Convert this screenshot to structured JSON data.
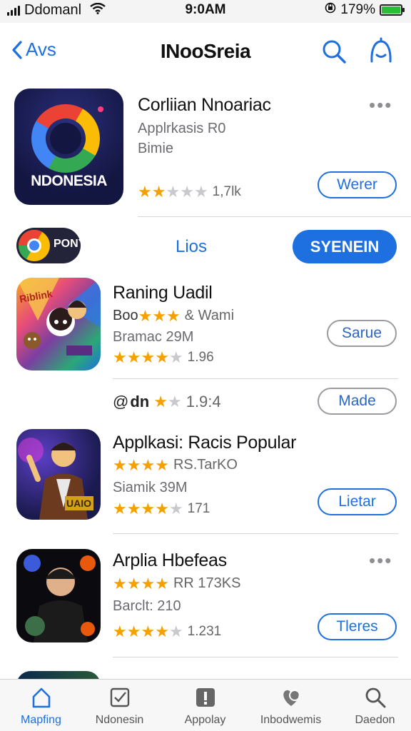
{
  "status_bar": {
    "carrier": "Ddomanl",
    "time": "9:0AM",
    "battery_pct": "179%",
    "icons": [
      "signal-icon",
      "wifi-icon",
      "orientation-lock-icon",
      "battery-icon"
    ]
  },
  "nav": {
    "back_label": "Avs",
    "title": "INooSreia",
    "icons": [
      "search-icon",
      "account-icon"
    ]
  },
  "featured": {
    "icon_text": "NDONESIA",
    "name": "Corliian Nnoariac",
    "subtitle": "Applrkasis R0",
    "category": "Bimie",
    "rating": 2,
    "rating_count": "1,7lk",
    "button": "Werer",
    "more": "•••"
  },
  "banner": {
    "badge_text": "PONY",
    "link": "Lios",
    "button": "SYENEIN"
  },
  "apps": [
    {
      "name": "Raning Uadil",
      "line1_prefix": "Boo",
      "line1_suffix": "& Wami",
      "sub": "Bramac 29M",
      "rating": 4,
      "count": "1.96",
      "button": "Sarue",
      "icon_text": "Riblink"
    },
    {
      "name": "",
      "line1_prefix": "dn",
      "line1_suffix": "",
      "sub": "",
      "rating": 1,
      "count": "1.9:4",
      "button": "Made",
      "icon_text": ""
    },
    {
      "name": "Applkasi: Racis Popular",
      "line1_prefix": "",
      "line1_suffix": "RS.TarKO",
      "sub": "Siamik 39M",
      "rating": 4,
      "count": "171",
      "button": "Lietar",
      "icon_text": "UAIO"
    },
    {
      "name": "Arplia Hbefeas",
      "line1_prefix": "",
      "line1_suffix": "RR 173KS",
      "sub": "Barclt: 210",
      "rating": 4,
      "count": "1.231",
      "button": "Tleres",
      "icon_text": "",
      "more": "•••"
    }
  ],
  "tabs": [
    {
      "label": "Mapfing",
      "icon": "home-icon"
    },
    {
      "label": "Ndonesin",
      "icon": "checkbox-icon"
    },
    {
      "label": "Appolay",
      "icon": "app-icon"
    },
    {
      "label": "Inbodwemis",
      "icon": "heart-search-icon"
    },
    {
      "label": "Daedon",
      "icon": "search-icon"
    }
  ],
  "colors": {
    "accent": "#1e6fe0",
    "star": "#f3a000",
    "status_bar_bg": "#f4f4f5"
  }
}
